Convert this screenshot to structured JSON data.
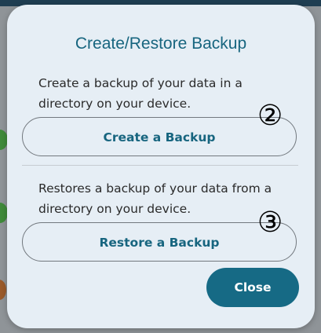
{
  "dialog": {
    "title": "Create/Restore Backup",
    "create_description": "Create a backup of your data in a directory on your device.",
    "create_button_label": "Create a Backup",
    "restore_description": "Restores a backup of your data from a directory on your device.",
    "restore_button_label": "Restore a Backup",
    "close_button_label": "Close"
  },
  "annotations": {
    "create_step": "②",
    "restore_step": "③"
  },
  "colors": {
    "accent": "#17657f",
    "close_button": "#166a85",
    "dialog_background": "#e6eef5",
    "scrim": "#8f9498"
  }
}
